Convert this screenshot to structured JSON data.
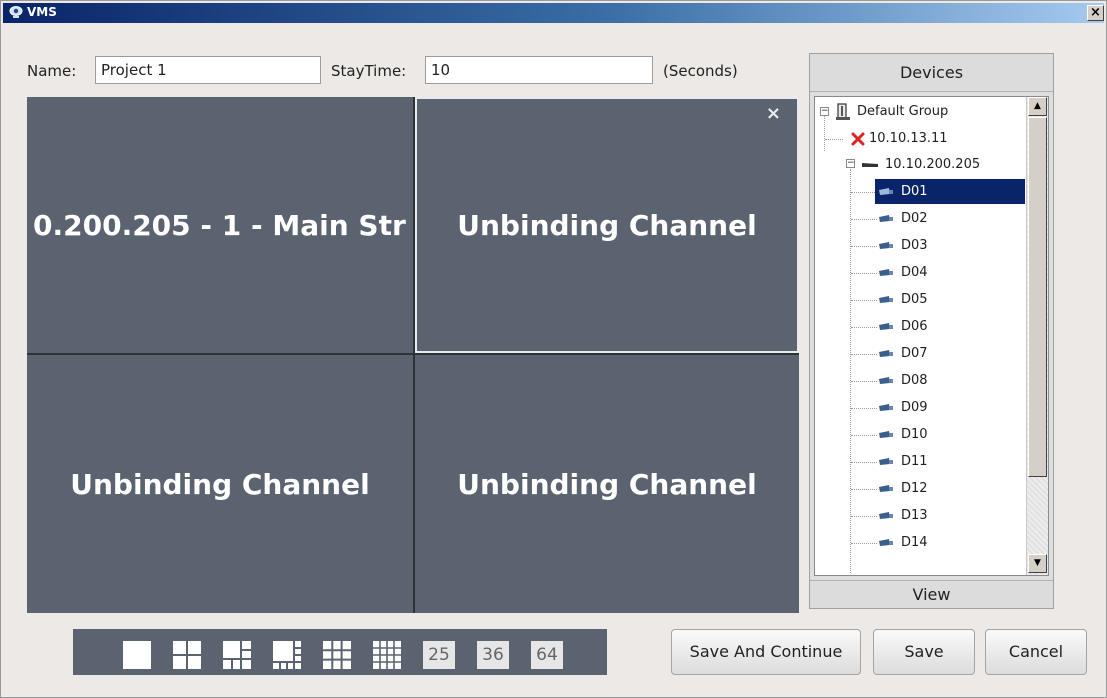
{
  "window": {
    "title": "VMS",
    "close_glyph": "×"
  },
  "form": {
    "name_label": "Name:",
    "name_value": "Project 1",
    "staytime_label": "StayTime:",
    "staytime_value": "10",
    "seconds_label": "(Seconds)"
  },
  "grid": {
    "cells": [
      {
        "label": "0.200.205 - 1 - Main Str",
        "selected": false
      },
      {
        "label": "Unbinding Channel",
        "selected": true,
        "close_glyph": "×"
      },
      {
        "label": "Unbinding Channel",
        "selected": false
      },
      {
        "label": "Unbinding Channel",
        "selected": false
      }
    ]
  },
  "devices": {
    "header": "Devices",
    "view_label": "View",
    "group": {
      "label": "Default Group",
      "icon": "group-icon"
    },
    "device_offline": {
      "label": "10.10.13.11",
      "icon": "offline-x-icon",
      "status_color": "#e02020"
    },
    "device_online": {
      "label": "10.10.200.205",
      "icon": "nvr-icon"
    },
    "channels": [
      "D01",
      "D02",
      "D03",
      "D04",
      "D05",
      "D06",
      "D07",
      "D08",
      "D09",
      "D10",
      "D11",
      "D12",
      "D13",
      "D14"
    ],
    "selected_channel": "D01",
    "scroll": {
      "up_glyph": "▲",
      "down_glyph": "▼"
    }
  },
  "layout_bar": {
    "icons": [
      "layout-1x1-icon",
      "layout-2x2-icon",
      "layout-1plus5-icon",
      "layout-1plus7-icon",
      "layout-3x3-icon",
      "layout-4x4-icon"
    ],
    "numbers": [
      "25",
      "36",
      "64"
    ]
  },
  "buttons": {
    "save_continue": "Save And Continue",
    "save": "Save",
    "cancel": "Cancel"
  },
  "colors": {
    "tile": "#5c6370",
    "title_bar": "#0a246a",
    "selection": "#0a246a"
  }
}
